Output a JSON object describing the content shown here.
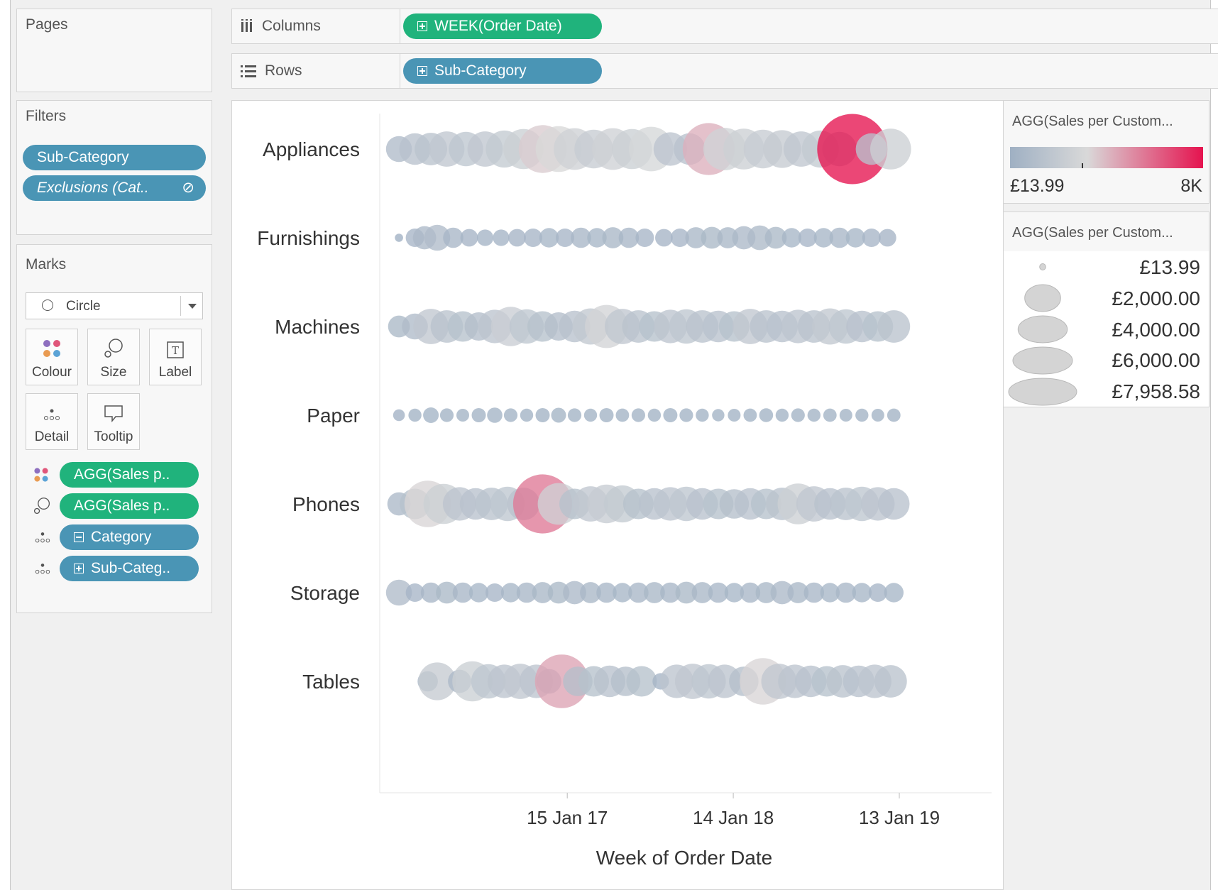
{
  "pages": {
    "title": "Pages"
  },
  "shelves": {
    "columns": {
      "label": "Columns",
      "pill": "WEEK(Order Date)"
    },
    "rows": {
      "label": "Rows",
      "pill": "Sub-Category"
    }
  },
  "filters": {
    "title": "Filters",
    "items": [
      "Sub-Category",
      "Exclusions (Cat.."
    ]
  },
  "marks": {
    "title": "Marks",
    "mark_type": "Circle",
    "buttons": {
      "colour": "Colour",
      "size": "Size",
      "label": "Label",
      "detail": "Detail",
      "tooltip": "Tooltip"
    },
    "fields": [
      {
        "icon": "colour-icon",
        "label": "AGG(Sales p..",
        "color": "#20b37c"
      },
      {
        "icon": "size-icon",
        "label": "AGG(Sales p..",
        "color": "#20b37c"
      },
      {
        "icon": "detail-icon",
        "label": "Category",
        "color": "#4a95b5"
      },
      {
        "icon": "detail-icon",
        "label": "Sub-Categ..",
        "color": "#4a95b5"
      }
    ]
  },
  "colour_legend": {
    "title": "AGG(Sales per Custom...",
    "min_label": "£13.99",
    "max_label": "8K",
    "start_color": "#9fb0c3",
    "mid_color": "#d9d9d9",
    "end_color": "#e5134f"
  },
  "size_legend": {
    "title": "AGG(Sales per Custom...",
    "items": [
      {
        "label": "£13.99",
        "value": 13.99
      },
      {
        "label": "£2,000.00",
        "value": 2000
      },
      {
        "label": "£4,000.00",
        "value": 4000
      },
      {
        "label": "£6,000.00",
        "value": 6000
      },
      {
        "label": "£7,958.58",
        "value": 7958.58
      }
    ]
  },
  "chart_data": {
    "type": "scatter",
    "xlabel": "Week of Order Date",
    "x_ticks": [
      "15 Jan 17",
      "14 Jan 18",
      "13 Jan 19"
    ],
    "categories": [
      "Appliances",
      "Furnishings",
      "Machines",
      "Paper",
      "Phones",
      "Storage",
      "Tables"
    ],
    "size_range": [
      13.99,
      7958.58
    ],
    "rows": [
      {
        "name": "Appliances",
        "points": [
          {
            "x": "2016-01-12",
            "v": 900
          },
          {
            "x": "2016-02-16",
            "v": 1400
          },
          {
            "x": "2016-03-22",
            "v": 1500
          },
          {
            "x": "2016-04-26",
            "v": 1800
          },
          {
            "x": "2016-06-07",
            "v": 1700
          },
          {
            "x": "2016-07-19",
            "v": 1800
          },
          {
            "x": "2016-08-30",
            "v": 2000
          },
          {
            "x": "2016-10-11",
            "v": 2400
          },
          {
            "x": "2016-11-22",
            "v": 3500
          },
          {
            "x": "2016-12-27",
            "v": 3200
          },
          {
            "x": "2017-01-31",
            "v": 2600
          },
          {
            "x": "2017-03-14",
            "v": 2200
          },
          {
            "x": "2017-04-25",
            "v": 2600
          },
          {
            "x": "2017-06-06",
            "v": 2400
          },
          {
            "x": "2017-07-18",
            "v": 3000
          },
          {
            "x": "2017-08-29",
            "v": 1600
          },
          {
            "x": "2017-10-10",
            "v": 1400
          },
          {
            "x": "2017-11-21",
            "v": 4200
          },
          {
            "x": "2017-12-26",
            "v": 2700
          },
          {
            "x": "2018-02-06",
            "v": 2500
          },
          {
            "x": "2018-03-20",
            "v": 2200
          },
          {
            "x": "2018-05-01",
            "v": 2100
          },
          {
            "x": "2018-06-12",
            "v": 1800
          },
          {
            "x": "2018-07-24",
            "v": 2000
          },
          {
            "x": "2018-09-04",
            "v": 1700
          },
          {
            "x": "2018-10-02",
            "v": 7958.58
          },
          {
            "x": "2018-11-13",
            "v": 1400
          },
          {
            "x": "2018-12-25",
            "v": 2500
          }
        ]
      },
      {
        "name": "Furnishings",
        "points": [
          {
            "x": "2016-01-12",
            "v": 40
          },
          {
            "x": "2016-02-16",
            "v": 400
          },
          {
            "x": "2016-03-08",
            "v": 700
          },
          {
            "x": "2016-04-05",
            "v": 900
          },
          {
            "x": "2016-05-10",
            "v": 500
          },
          {
            "x": "2016-06-14",
            "v": 350
          },
          {
            "x": "2016-07-19",
            "v": 300
          },
          {
            "x": "2016-08-23",
            "v": 300
          },
          {
            "x": "2016-09-27",
            "v": 350
          },
          {
            "x": "2016-11-01",
            "v": 400
          },
          {
            "x": "2016-12-06",
            "v": 450
          },
          {
            "x": "2017-01-10",
            "v": 400
          },
          {
            "x": "2017-02-14",
            "v": 500
          },
          {
            "x": "2017-03-21",
            "v": 450
          },
          {
            "x": "2017-04-25",
            "v": 550
          },
          {
            "x": "2017-05-30",
            "v": 500
          },
          {
            "x": "2017-07-04",
            "v": 400
          },
          {
            "x": "2017-08-15",
            "v": 350
          },
          {
            "x": "2017-09-19",
            "v": 400
          },
          {
            "x": "2017-10-24",
            "v": 550
          },
          {
            "x": "2017-11-28",
            "v": 600
          },
          {
            "x": "2018-01-02",
            "v": 550
          },
          {
            "x": "2018-02-06",
            "v": 700
          },
          {
            "x": "2018-03-13",
            "v": 800
          },
          {
            "x": "2018-04-17",
            "v": 600
          },
          {
            "x": "2018-05-22",
            "v": 450
          },
          {
            "x": "2018-06-26",
            "v": 400
          },
          {
            "x": "2018-07-31",
            "v": 450
          },
          {
            "x": "2018-09-04",
            "v": 500
          },
          {
            "x": "2018-10-09",
            "v": 450
          },
          {
            "x": "2018-11-13",
            "v": 400
          },
          {
            "x": "2018-12-18",
            "v": 350
          }
        ]
      },
      {
        "name": "Machines",
        "points": [
          {
            "x": "2016-01-12",
            "v": 600
          },
          {
            "x": "2016-02-16",
            "v": 900
          },
          {
            "x": "2016-03-22",
            "v": 1800
          },
          {
            "x": "2016-04-26",
            "v": 1500
          },
          {
            "x": "2016-05-31",
            "v": 1300
          },
          {
            "x": "2016-07-05",
            "v": 1100
          },
          {
            "x": "2016-08-09",
            "v": 1600
          },
          {
            "x": "2016-09-13",
            "v": 2300
          },
          {
            "x": "2016-10-18",
            "v": 1700
          },
          {
            "x": "2016-11-22",
            "v": 1300
          },
          {
            "x": "2016-12-27",
            "v": 1100
          },
          {
            "x": "2017-01-31",
            "v": 1400
          },
          {
            "x": "2017-03-07",
            "v": 1900
          },
          {
            "x": "2017-04-11",
            "v": 2800
          },
          {
            "x": "2017-05-16",
            "v": 1800
          },
          {
            "x": "2017-06-20",
            "v": 1500
          },
          {
            "x": "2017-07-25",
            "v": 1300
          },
          {
            "x": "2017-08-29",
            "v": 1600
          },
          {
            "x": "2017-10-03",
            "v": 1700
          },
          {
            "x": "2017-11-07",
            "v": 1500
          },
          {
            "x": "2017-12-12",
            "v": 1400
          },
          {
            "x": "2018-01-16",
            "v": 1300
          },
          {
            "x": "2018-02-20",
            "v": 1800
          },
          {
            "x": "2018-03-27",
            "v": 1500
          },
          {
            "x": "2018-05-01",
            "v": 1400
          },
          {
            "x": "2018-06-05",
            "v": 1600
          },
          {
            "x": "2018-07-10",
            "v": 1500
          },
          {
            "x": "2018-08-14",
            "v": 1900
          },
          {
            "x": "2018-09-18",
            "v": 1700
          },
          {
            "x": "2018-10-23",
            "v": 1400
          },
          {
            "x": "2018-11-27",
            "v": 1300
          },
          {
            "x": "2019-01-01",
            "v": 1500
          }
        ]
      },
      {
        "name": "Paper",
        "points": [
          {
            "x": "2016-01-12",
            "v": 120
          },
          {
            "x": "2016-02-16",
            "v": 160
          },
          {
            "x": "2016-03-22",
            "v": 260
          },
          {
            "x": "2016-04-26",
            "v": 180
          },
          {
            "x": "2016-05-31",
            "v": 150
          },
          {
            "x": "2016-07-05",
            "v": 200
          },
          {
            "x": "2016-08-09",
            "v": 250
          },
          {
            "x": "2016-09-13",
            "v": 180
          },
          {
            "x": "2016-10-18",
            "v": 160
          },
          {
            "x": "2016-11-22",
            "v": 200
          },
          {
            "x": "2016-12-27",
            "v": 230
          },
          {
            "x": "2017-01-31",
            "v": 180
          },
          {
            "x": "2017-03-07",
            "v": 160
          },
          {
            "x": "2017-04-11",
            "v": 200
          },
          {
            "x": "2017-05-16",
            "v": 170
          },
          {
            "x": "2017-06-20",
            "v": 180
          },
          {
            "x": "2017-07-25",
            "v": 160
          },
          {
            "x": "2017-08-29",
            "v": 200
          },
          {
            "x": "2017-10-03",
            "v": 180
          },
          {
            "x": "2017-11-07",
            "v": 160
          },
          {
            "x": "2017-12-12",
            "v": 140
          },
          {
            "x": "2018-01-16",
            "v": 150
          },
          {
            "x": "2018-02-20",
            "v": 170
          },
          {
            "x": "2018-03-27",
            "v": 190
          },
          {
            "x": "2018-05-01",
            "v": 160
          },
          {
            "x": "2018-06-05",
            "v": 180
          },
          {
            "x": "2018-07-10",
            "v": 160
          },
          {
            "x": "2018-08-14",
            "v": 170
          },
          {
            "x": "2018-09-18",
            "v": 150
          },
          {
            "x": "2018-10-23",
            "v": 160
          },
          {
            "x": "2018-11-27",
            "v": 150
          },
          {
            "x": "2019-01-01",
            "v": 170
          }
        ]
      },
      {
        "name": "Phones",
        "points": [
          {
            "x": "2016-01-12",
            "v": 700
          },
          {
            "x": "2016-02-16",
            "v": 1300
          },
          {
            "x": "2016-03-15",
            "v": 3300
          },
          {
            "x": "2016-04-19",
            "v": 2400
          },
          {
            "x": "2016-05-24",
            "v": 1600
          },
          {
            "x": "2016-06-28",
            "v": 1400
          },
          {
            "x": "2016-08-02",
            "v": 1500
          },
          {
            "x": "2016-09-06",
            "v": 1700
          },
          {
            "x": "2016-10-11",
            "v": 1500
          },
          {
            "x": "2016-11-22",
            "v": 5500
          },
          {
            "x": "2016-12-27",
            "v": 2600
          },
          {
            "x": "2017-01-31",
            "v": 1300
          },
          {
            "x": "2017-03-07",
            "v": 1800
          },
          {
            "x": "2017-04-11",
            "v": 2200
          },
          {
            "x": "2017-05-16",
            "v": 2000
          },
          {
            "x": "2017-06-20",
            "v": 1300
          },
          {
            "x": "2017-07-25",
            "v": 1400
          },
          {
            "x": "2017-08-29",
            "v": 1600
          },
          {
            "x": "2017-10-03",
            "v": 1700
          },
          {
            "x": "2017-11-07",
            "v": 1400
          },
          {
            "x": "2017-12-12",
            "v": 1300
          },
          {
            "x": "2018-01-16",
            "v": 1200
          },
          {
            "x": "2018-02-20",
            "v": 1400
          },
          {
            "x": "2018-03-27",
            "v": 1300
          },
          {
            "x": "2018-05-01",
            "v": 1500
          },
          {
            "x": "2018-06-05",
            "v": 2500
          },
          {
            "x": "2018-07-10",
            "v": 1800
          },
          {
            "x": "2018-08-14",
            "v": 1400
          },
          {
            "x": "2018-09-18",
            "v": 1500
          },
          {
            "x": "2018-10-23",
            "v": 1700
          },
          {
            "x": "2018-11-27",
            "v": 1600
          },
          {
            "x": "2019-01-01",
            "v": 1400
          }
        ]
      },
      {
        "name": "Storage",
        "points": [
          {
            "x": "2016-01-12",
            "v": 900
          },
          {
            "x": "2016-02-16",
            "v": 400
          },
          {
            "x": "2016-03-22",
            "v": 500
          },
          {
            "x": "2016-04-26",
            "v": 600
          },
          {
            "x": "2016-05-31",
            "v": 500
          },
          {
            "x": "2016-07-05",
            "v": 450
          },
          {
            "x": "2016-08-09",
            "v": 400
          },
          {
            "x": "2016-09-13",
            "v": 450
          },
          {
            "x": "2016-10-18",
            "v": 500
          },
          {
            "x": "2016-11-22",
            "v": 550
          },
          {
            "x": "2016-12-27",
            "v": 600
          },
          {
            "x": "2017-01-31",
            "v": 700
          },
          {
            "x": "2017-03-07",
            "v": 550
          },
          {
            "x": "2017-04-11",
            "v": 500
          },
          {
            "x": "2017-05-16",
            "v": 450
          },
          {
            "x": "2017-06-20",
            "v": 500
          },
          {
            "x": "2017-07-25",
            "v": 550
          },
          {
            "x": "2017-08-29",
            "v": 500
          },
          {
            "x": "2017-10-03",
            "v": 600
          },
          {
            "x": "2017-11-07",
            "v": 550
          },
          {
            "x": "2017-12-12",
            "v": 500
          },
          {
            "x": "2018-01-16",
            "v": 450
          },
          {
            "x": "2018-02-20",
            "v": 500
          },
          {
            "x": "2018-03-27",
            "v": 550
          },
          {
            "x": "2018-05-01",
            "v": 700
          },
          {
            "x": "2018-06-05",
            "v": 550
          },
          {
            "x": "2018-07-10",
            "v": 500
          },
          {
            "x": "2018-08-14",
            "v": 450
          },
          {
            "x": "2018-09-18",
            "v": 500
          },
          {
            "x": "2018-10-23",
            "v": 450
          },
          {
            "x": "2018-11-27",
            "v": 400
          },
          {
            "x": "2019-01-01",
            "v": 450
          }
        ]
      },
      {
        "name": "Tables",
        "points": [
          {
            "x": "2016-03-15",
            "v": 500
          },
          {
            "x": "2016-04-05",
            "v": 2100
          },
          {
            "x": "2016-05-24",
            "v": 700
          },
          {
            "x": "2016-06-21",
            "v": 2400
          },
          {
            "x": "2016-07-26",
            "v": 1700
          },
          {
            "x": "2016-08-30",
            "v": 1600
          },
          {
            "x": "2016-10-04",
            "v": 1800
          },
          {
            "x": "2016-11-08",
            "v": 1600
          },
          {
            "x": "2016-12-06",
            "v": 800
          },
          {
            "x": "2017-01-03",
            "v": 4500
          },
          {
            "x": "2017-02-07",
            "v": 1200
          },
          {
            "x": "2017-03-14",
            "v": 1300
          },
          {
            "x": "2017-04-18",
            "v": 1400
          },
          {
            "x": "2017-05-23",
            "v": 1200
          },
          {
            "x": "2017-06-27",
            "v": 1300
          },
          {
            "x": "2017-08-08",
            "v": 300
          },
          {
            "x": "2017-09-12",
            "v": 1600
          },
          {
            "x": "2017-10-17",
            "v": 1800
          },
          {
            "x": "2017-11-21",
            "v": 1700
          },
          {
            "x": "2017-12-26",
            "v": 1600
          },
          {
            "x": "2018-02-06",
            "v": 1200
          },
          {
            "x": "2018-03-20",
            "v": 3300
          },
          {
            "x": "2018-04-24",
            "v": 1800
          },
          {
            "x": "2018-05-29",
            "v": 1600
          },
          {
            "x": "2018-07-03",
            "v": 1400
          },
          {
            "x": "2018-08-07",
            "v": 1300
          },
          {
            "x": "2018-09-11",
            "v": 1500
          },
          {
            "x": "2018-10-16",
            "v": 1400
          },
          {
            "x": "2018-11-20",
            "v": 1600
          },
          {
            "x": "2018-12-25",
            "v": 1500
          }
        ]
      }
    ]
  }
}
